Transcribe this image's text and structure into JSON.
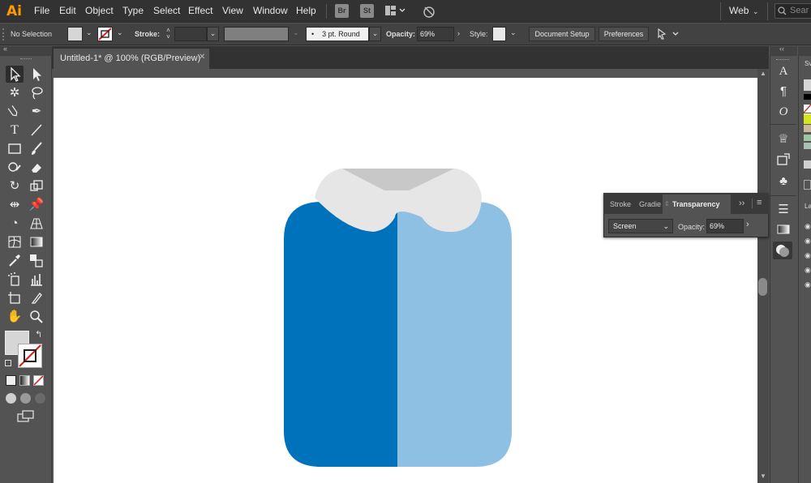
{
  "app": {
    "logo": "Ai"
  },
  "menu": {
    "items": [
      "File",
      "Edit",
      "Object",
      "Type",
      "Select",
      "Effect",
      "View",
      "Window",
      "Help"
    ]
  },
  "menubar_badges": {
    "bridge": "Br",
    "stock": "St"
  },
  "workspace": {
    "label": "Web"
  },
  "search": {
    "placeholder": "Sear"
  },
  "control_bar": {
    "selection": "No Selection",
    "stroke_label": "Stroke:",
    "brush": "3 pt. Round",
    "brush_bullet": "•",
    "opacity_label": "Opacity:",
    "opacity_value": "69%",
    "style_label": "Style:",
    "document_setup": "Document Setup",
    "preferences": "Preferences"
  },
  "document_tab": {
    "title": "Untitled-1* @ 100% (RGB/Preview)",
    "close": "✕"
  },
  "transparency_panel": {
    "tabs": [
      "Stroke",
      "Gradie",
      "Transparency"
    ],
    "blend_mode": "Screen",
    "opacity_label": "Opacity:",
    "opacity_value": "69%"
  },
  "artwork": {
    "shirt_left_color": "#0072bc",
    "shirt_right_color": "#8dc0e2",
    "collar_color": "#e6e6e6",
    "collar_inner_color": "#c8c8c8"
  },
  "right_panel": {
    "layers_letter": "La",
    "swatches_letter": "Sv"
  },
  "colors": {
    "accent": "#ff9a00",
    "ui_dark": "#323232",
    "ui_mid": "#535353"
  }
}
